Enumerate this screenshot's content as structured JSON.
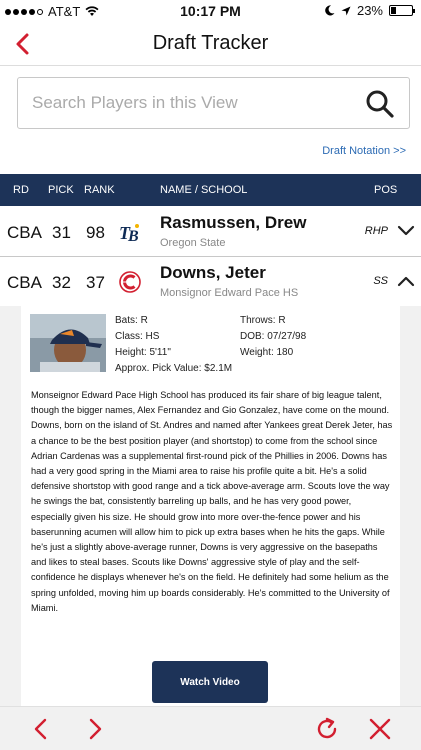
{
  "status_bar": {
    "carrier": "AT&T",
    "time": "10:17 PM",
    "battery": "23%",
    "battery_level": 0.23,
    "icons": [
      "signal-dots",
      "wifi-icon",
      "moon-icon",
      "location-arrow-icon",
      "battery-icon"
    ]
  },
  "nav": {
    "title": "Draft Tracker",
    "back_icon": "chevron-left-icon"
  },
  "search": {
    "placeholder": "Search Players in this View",
    "value": "",
    "icon": "search-icon"
  },
  "draft_notation": "Draft Notation >>",
  "table": {
    "headers": {
      "rd": "RD",
      "pick": "PICK",
      "rank": "RANK",
      "name_school": "NAME / SCHOOL",
      "pos": "POS"
    },
    "rows": [
      {
        "rd": "CBA",
        "pick": "31",
        "rank": "98",
        "team": "TB",
        "name": "Rasmussen, Drew",
        "school": "Oregon State",
        "pos": "RHP",
        "expanded": false
      },
      {
        "rd": "CBA",
        "pick": "32",
        "rank": "37",
        "team": "C",
        "name": "Downs, Jeter",
        "school": "Monsignor Edward Pace HS",
        "pos": "SS",
        "expanded": true
      }
    ]
  },
  "detail": {
    "bats": "Bats: R",
    "throws": "Throws: R",
    "class": "Class: HS",
    "dob": "DOB: 07/27/98",
    "height": "Height: 5'11\"",
    "weight": "Weight: 180",
    "pick_value": "Approx. Pick Value: $2.1M",
    "bio": "Monseignor Edward Pace High School has produced its fair share of big league talent, though the bigger names, Alex Fernandez and Gio Gonzalez, have come on the mound. Downs, born on the island of St. Andres and named after Yankees great Derek Jeter, has a chance to be the best position player (and shortstop) to come from the school since Adrian Cardenas was a supplemental first-round pick of the Phillies in 2006. Downs has had a very good spring in the Miami area to raise his profile quite a bit. He's a solid defensive shortstop with good range and a tick above-average arm. Scouts love the way he swings the bat, consistently barreling up balls, and he has very good power, especially given his size. He should grow into more over-the-fence power and his baserunning acumen will allow him to pick up extra bases when he hits the gaps. While he's just a slightly above-average runner, Downs is very aggressive on the basepaths and likes to steal bases. Scouts like Downs' aggressive style of play and the self-confidence he displays whenever he's on the field. He definitely had some helium as the spring unfolded, moving him up boards considerably. He's committed to the University of Miami.",
    "watch_video": "Watch Video"
  },
  "bottom_bar": {
    "icons": [
      "chevron-left-icon",
      "chevron-right-icon",
      "refresh-icon",
      "close-icon"
    ]
  },
  "colors": {
    "accent_red": "#d21f30",
    "header_navy": "#1d3358",
    "link_blue": "#2c6bb4"
  }
}
